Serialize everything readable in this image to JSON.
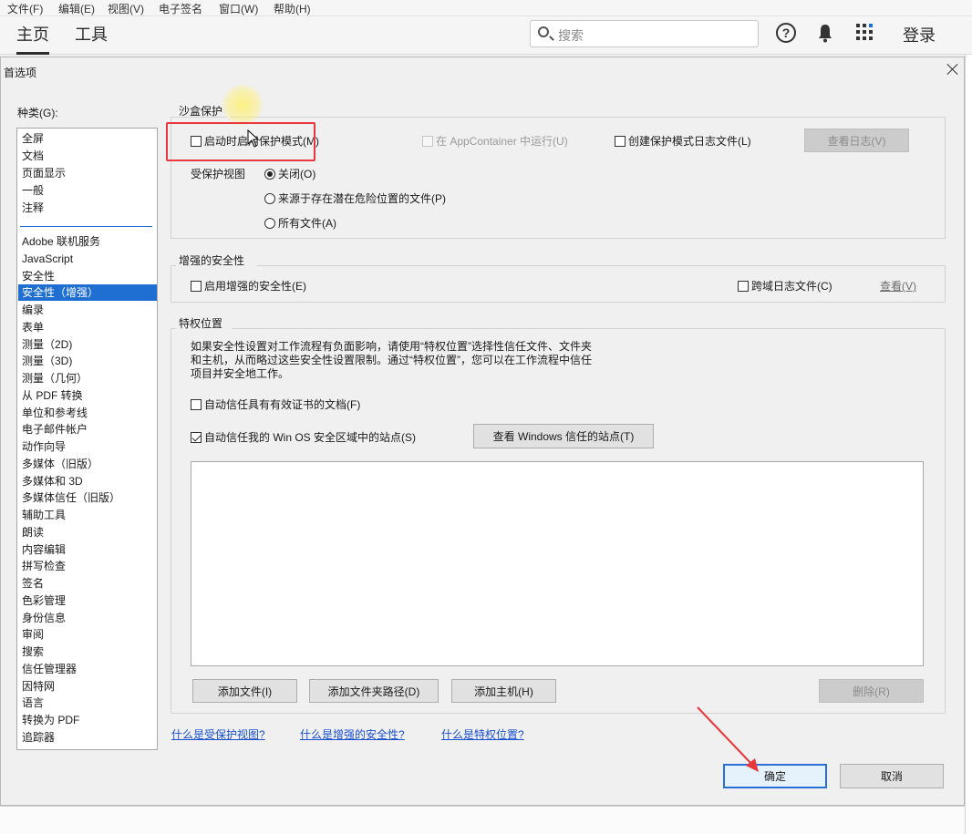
{
  "menubar": [
    "文件(F)",
    "编辑(E)",
    "视图(V)",
    "电子签名",
    "窗口(W)",
    "帮助(H)"
  ],
  "app_tabs": {
    "home": "主页",
    "tools": "工具"
  },
  "search": {
    "placeholder": "搜索"
  },
  "header": {
    "help_glyph": "?",
    "login": "登录"
  },
  "dialog": {
    "title": "首选项",
    "category_label": "种类(G):",
    "categories_top": [
      "全屏",
      "文档",
      "页面显示",
      "一般",
      "注释"
    ],
    "categories": [
      "Adobe 联机服务",
      "JavaScript",
      "安全性",
      "安全性（增强）",
      "编录",
      "表单",
      "测量（2D)",
      "测量（3D)",
      "测量（几何）",
      "从 PDF 转换",
      "单位和参考线",
      "电子邮件帐户",
      "动作向导",
      "多媒体（旧版）",
      "多媒体和 3D",
      "多媒体信任（旧版）",
      "辅助工具",
      "朗读",
      "内容编辑",
      "拼写检查",
      "签名",
      "色彩管理",
      "身份信息",
      "审阅",
      "搜索",
      "信任管理器",
      "因特网",
      "语言",
      "转换为 PDF",
      "追踪器"
    ],
    "selected_category": "安全性（增强）",
    "sandbox": {
      "title": "沙盒保护",
      "enable_protected_mode": {
        "label": "启动时启用保护模式(M)",
        "checked": false
      },
      "run_in_appcontainer": {
        "label": "在 AppContainer 中运行(U)",
        "checked": false,
        "disabled": true
      },
      "create_log": {
        "label": "创建保护模式日志文件(L)",
        "checked": false
      },
      "view_log": "查看日志(V)",
      "protected_view_label": "受保护视图",
      "protected_view_options": [
        "关闭(O)",
        "来源于存在潜在危险位置的文件(P)",
        "所有文件(A)"
      ],
      "protected_view_selected": "关闭(O)"
    },
    "enhanced": {
      "title": "增强的安全性",
      "enable_enhanced": {
        "label": "启用增强的安全性(E)",
        "checked": false
      },
      "cross_domain_log": {
        "label": "跨域日志文件(C)",
        "checked": false
      },
      "view": "查看(V)"
    },
    "privileged": {
      "title": "特权位置",
      "description_lines": [
        "如果安全性设置对工作流程有负面影响，请使用“特权位置”选择性信任文件、文件夹",
        "和主机，从而略过这些安全性设置限制。通过“特权位置”，您可以在工作流程中信任",
        "项目并安全地工作。"
      ],
      "auto_trust_certified": {
        "label": "自动信任具有有效证书的文档(F)",
        "checked": false
      },
      "auto_trust_win_os": {
        "label": "自动信任我的 Win OS 安全区域中的站点(S)",
        "checked": true
      },
      "view_windows_trusted": "查看 Windows 信任的站点(T)",
      "add_file": "添加文件(I)",
      "add_folder_path": "添加文件夹路径(D)",
      "add_host": "添加主机(H)",
      "remove": "删除(R)"
    },
    "help_links": [
      "什么是受保护视图?",
      "什么是增强的安全性?",
      "什么是特权位置?"
    ],
    "ok": "确定",
    "cancel": "取消"
  },
  "colors": {
    "selection": "#1e6fd1",
    "link": "#1a4fcf",
    "annotation_red": "#e8383d"
  }
}
